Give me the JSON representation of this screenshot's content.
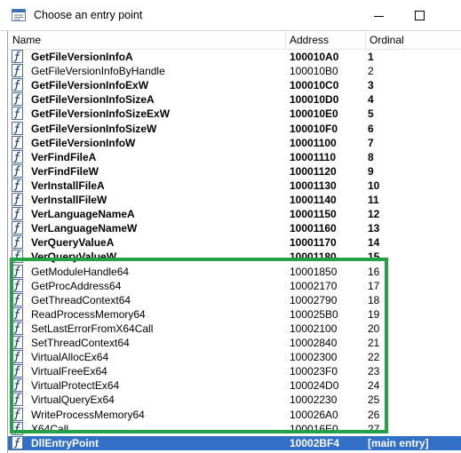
{
  "window": {
    "title": "Choose an entry point",
    "app_icon": "dialog-app-icon",
    "minimize_icon": "minimize-icon",
    "maximize_icon": "maximize-icon",
    "accent_selection": "#3270c8",
    "highlight_color": "#22a244"
  },
  "columns": {
    "name": "Name",
    "address": "Address",
    "ordinal": "Ordinal"
  },
  "rows": [
    {
      "name": "GetFileVersionInfoA",
      "address": "100010A0",
      "ordinal": "1",
      "bold": true
    },
    {
      "name": "GetFileVersionInfoByHandle",
      "address": "100010B0",
      "ordinal": "2",
      "bold": false
    },
    {
      "name": "GetFileVersionInfoExW",
      "address": "100010C0",
      "ordinal": "3",
      "bold": true
    },
    {
      "name": "GetFileVersionInfoSizeA",
      "address": "100010D0",
      "ordinal": "4",
      "bold": true
    },
    {
      "name": "GetFileVersionInfoSizeExW",
      "address": "100010E0",
      "ordinal": "5",
      "bold": true
    },
    {
      "name": "GetFileVersionInfoSizeW",
      "address": "100010F0",
      "ordinal": "6",
      "bold": true
    },
    {
      "name": "GetFileVersionInfoW",
      "address": "10001100",
      "ordinal": "7",
      "bold": true
    },
    {
      "name": "VerFindFileA",
      "address": "10001110",
      "ordinal": "8",
      "bold": true
    },
    {
      "name": "VerFindFileW",
      "address": "10001120",
      "ordinal": "9",
      "bold": true
    },
    {
      "name": "VerInstallFileA",
      "address": "10001130",
      "ordinal": "10",
      "bold": true
    },
    {
      "name": "VerInstallFileW",
      "address": "10001140",
      "ordinal": "11",
      "bold": true
    },
    {
      "name": "VerLanguageNameA",
      "address": "10001150",
      "ordinal": "12",
      "bold": true
    },
    {
      "name": "VerLanguageNameW",
      "address": "10001160",
      "ordinal": "13",
      "bold": true
    },
    {
      "name": "VerQueryValueA",
      "address": "10001170",
      "ordinal": "14",
      "bold": true
    },
    {
      "name": "VerQueryValueW",
      "address": "10001180",
      "ordinal": "15",
      "bold": true
    },
    {
      "name": "GetModuleHandle64",
      "address": "10001850",
      "ordinal": "16",
      "bold": false
    },
    {
      "name": "GetProcAddress64",
      "address": "10002170",
      "ordinal": "17",
      "bold": false
    },
    {
      "name": "GetThreadContext64",
      "address": "10002790",
      "ordinal": "18",
      "bold": false
    },
    {
      "name": "ReadProcessMemory64",
      "address": "100025B0",
      "ordinal": "19",
      "bold": false
    },
    {
      "name": "SetLastErrorFromX64Call",
      "address": "10002100",
      "ordinal": "20",
      "bold": false
    },
    {
      "name": "SetThreadContext64",
      "address": "10002840",
      "ordinal": "21",
      "bold": false
    },
    {
      "name": "VirtualAllocEx64",
      "address": "10002300",
      "ordinal": "22",
      "bold": false
    },
    {
      "name": "VirtualFreeEx64",
      "address": "100023F0",
      "ordinal": "23",
      "bold": false
    },
    {
      "name": "VirtualProtectEx64",
      "address": "100024D0",
      "ordinal": "24",
      "bold": false
    },
    {
      "name": "VirtualQueryEx64",
      "address": "10002230",
      "ordinal": "25",
      "bold": false
    },
    {
      "name": "WriteProcessMemory64",
      "address": "100026A0",
      "ordinal": "26",
      "bold": false
    },
    {
      "name": "X64Call",
      "address": "100016E0",
      "ordinal": "27",
      "bold": false
    },
    {
      "name": "DllEntryPoint",
      "address": "10002BF4",
      "ordinal": "[main entry]",
      "bold": true,
      "selected": true
    }
  ]
}
